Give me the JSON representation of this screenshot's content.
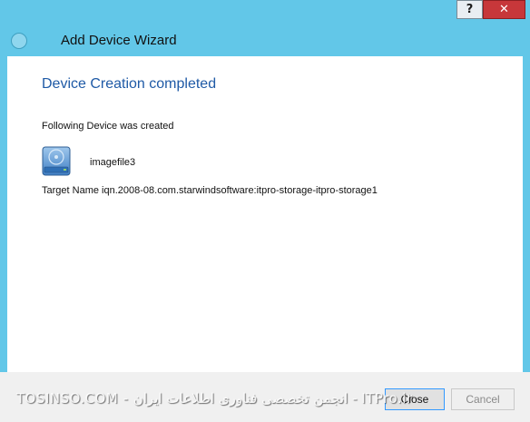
{
  "window": {
    "title": "Add Device Wizard",
    "help_label": "?",
    "close_glyph": "✕"
  },
  "content": {
    "heading": "Device Creation completed",
    "message": "Following Device was created",
    "device": {
      "icon": "hard-disk-icon",
      "name": "imagefile3"
    },
    "target_line": "Target Name iqn.2008-08.com.starwindsoftware:itpro-storage-itpro-storage1"
  },
  "footer": {
    "close_label": "Close",
    "cancel_label": "Cancel"
  },
  "watermark": "TOSINSO.COM - انجمن تخصصی فناوری اطلاعات ایران - ITPro.ir",
  "colors": {
    "frame": "#62c7e8",
    "heading": "#1f5aa6",
    "close_button": "#c7373a"
  }
}
